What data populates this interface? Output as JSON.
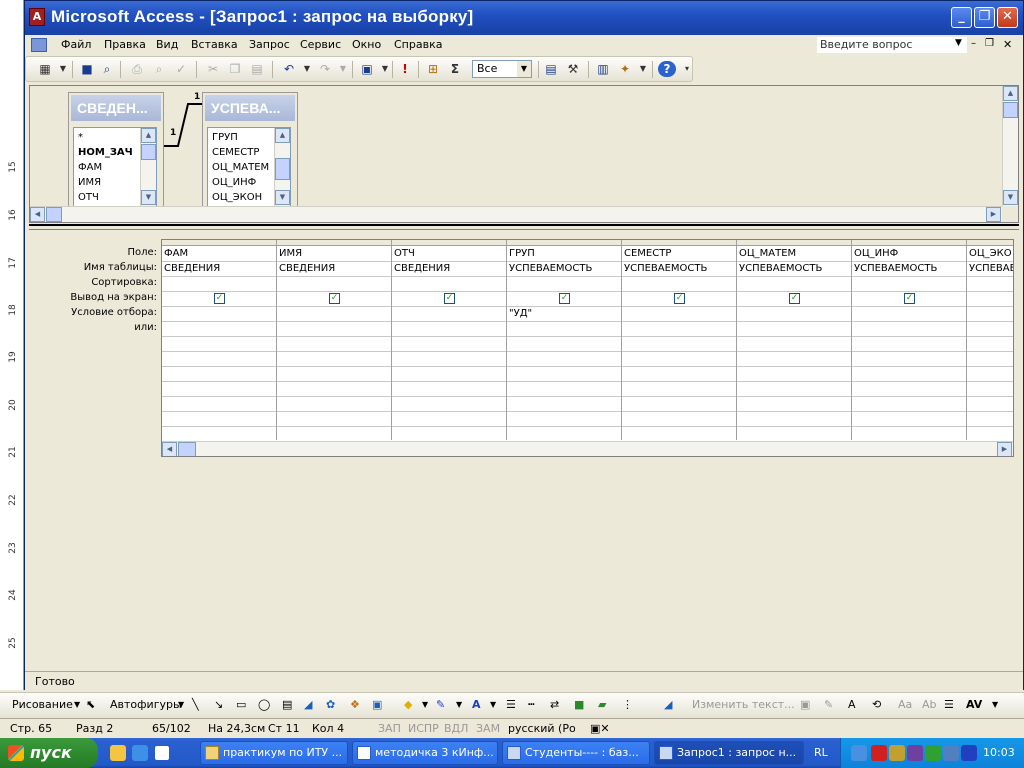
{
  "window": {
    "title": "Microsoft Access - [Запрос1 : запрос на выборку]",
    "min_label": "_",
    "max_label": "❐",
    "close_label": "✕"
  },
  "menu": {
    "items": [
      "Файл",
      "Правка",
      "Вид",
      "Вставка",
      "Запрос",
      "Сервис",
      "Окно",
      "Справка"
    ],
    "question_placeholder": "Введите вопрос"
  },
  "toolbar": {
    "top_values": "Все",
    "sigma": "Σ",
    "exclam": "!"
  },
  "tables": [
    {
      "title": "СВЕДЕН...",
      "fields": [
        "*",
        "НОМ_ЗАЧ",
        "ФАМ",
        "ИМЯ",
        "ОТЧ"
      ],
      "key_field": "НОМ_ЗАЧ"
    },
    {
      "title": "УСПЕВА...",
      "fields": [
        "ГРУП",
        "СЕМЕСТР",
        "ОЦ_МАТЕМ",
        "ОЦ_ИНФ",
        "ОЦ_ЭКОН"
      ]
    }
  ],
  "relation": {
    "left_label": "1",
    "right_label": "1"
  },
  "grid": {
    "row_labels": [
      "Поле:",
      "Имя таблицы:",
      "Сортировка:",
      "Вывод на экран:",
      "Условие отбора:",
      "или:"
    ],
    "columns": [
      {
        "field": "ФАМ",
        "table": "СВЕДЕНИЯ",
        "show": true,
        "criteria": ""
      },
      {
        "field": "ИМЯ",
        "table": "СВЕДЕНИЯ",
        "show": true,
        "criteria": ""
      },
      {
        "field": "ОТЧ",
        "table": "СВЕДЕНИЯ",
        "show": true,
        "criteria": ""
      },
      {
        "field": "ГРУП",
        "table": "УСПЕВАЕМОСТЬ",
        "show": true,
        "criteria": "\"УД\""
      },
      {
        "field": "СЕМЕСТР",
        "table": "УСПЕВАЕМОСТЬ",
        "show": true,
        "criteria": ""
      },
      {
        "field": "ОЦ_МАТЕМ",
        "table": "УСПЕВАЕМОСТЬ",
        "show": true,
        "criteria": ""
      },
      {
        "field": "ОЦ_ИНФ",
        "table": "УСПЕВАЕМОСТЬ",
        "show": true,
        "criteria": ""
      },
      {
        "field": "ОЦ_ЭКО",
        "table": "УСПЕВАЕ",
        "show": false,
        "criteria": ""
      }
    ]
  },
  "status": {
    "ready": "Готово"
  },
  "drawing": {
    "draw": "Рисование",
    "autoshapes": "Автофигуры",
    "change_text": "Изменить текст..."
  },
  "word_status": {
    "page": "Стр. 65",
    "section": "Разд 2",
    "pages": "65/102",
    "at": "На 24,3см",
    "line": "Ст 11",
    "col": "Кол 4",
    "rec": "ЗАП",
    "trk": "ИСПР",
    "ext": "ВДЛ",
    "ovr": "ЗАМ",
    "lang": "русский (Ро"
  },
  "ruler_marks": [
    "15",
    "16",
    "17",
    "18",
    "19",
    "20",
    "21",
    "22",
    "23",
    "24",
    "25"
  ],
  "taskbar": {
    "start": "пуск",
    "buttons": [
      "практикум по ИТУ ...",
      "методичка 3 кИнф...",
      "Студенты---- : баз...",
      "Запрос1 : запрос н..."
    ],
    "lang": "RL",
    "clock": "10:03"
  }
}
